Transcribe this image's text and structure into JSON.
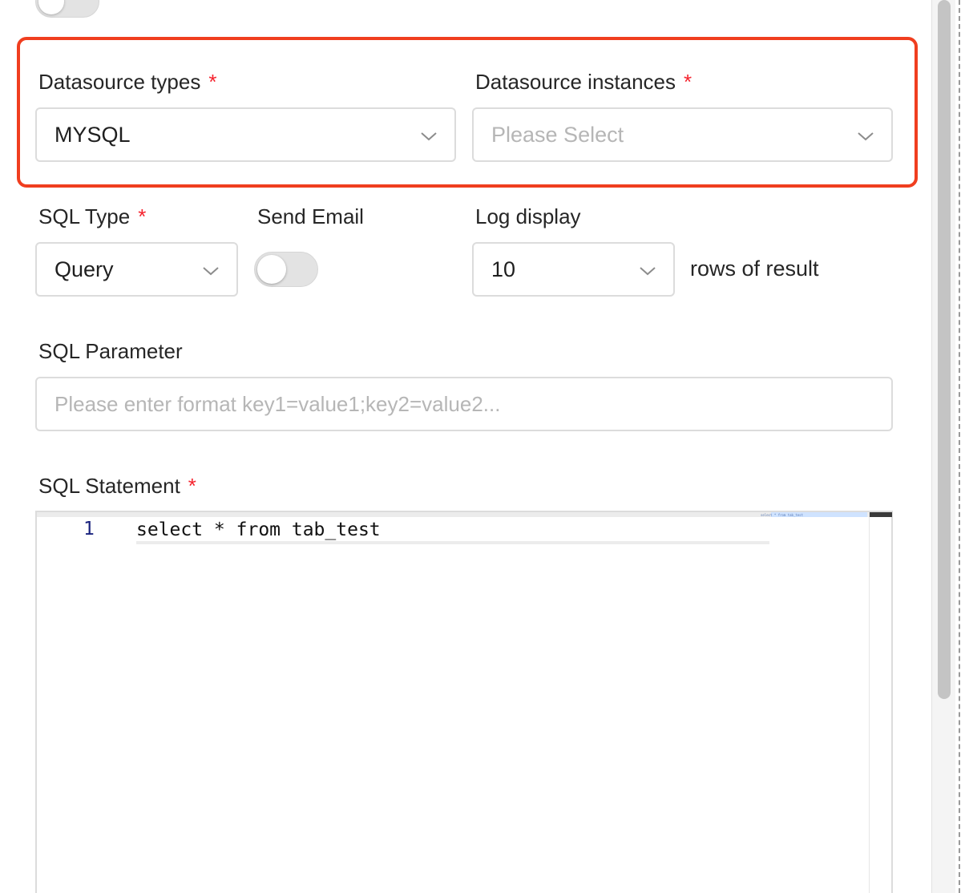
{
  "datasource": {
    "types_label": "Datasource types",
    "types_value": "MYSQL",
    "instances_label": "Datasource instances",
    "instances_placeholder": "Please Select",
    "required_mark": "*"
  },
  "sql_type": {
    "label": "SQL Type",
    "value": "Query"
  },
  "send_email": {
    "label": "Send Email",
    "enabled": false
  },
  "log_display": {
    "label": "Log display",
    "value": "10",
    "suffix": "rows of result"
  },
  "sql_parameter": {
    "label": "SQL Parameter",
    "placeholder": "Please enter format key1=value1;key2=value2..."
  },
  "sql_statement": {
    "label": "SQL Statement",
    "line_number": "1",
    "code": "select * from tab_test",
    "minimap_text": "select * from tab_test"
  },
  "colors": {
    "required": "#f5222d",
    "highlight_border": "#f03e1f",
    "placeholder": "#b6b6b6"
  }
}
